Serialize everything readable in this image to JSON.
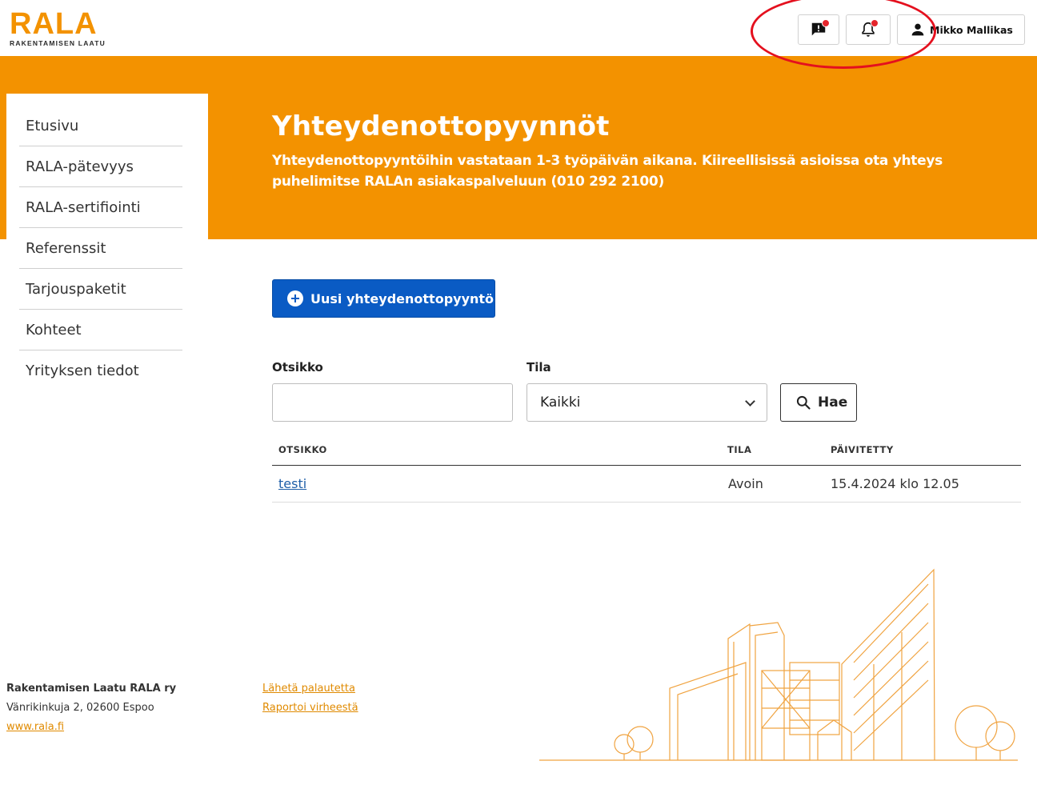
{
  "brand": {
    "logo_text": "RALA",
    "logo_subtitle": "RAKENTAMISEN LAATU",
    "accent_color": "#f39200",
    "primary_button_color": "#0a5bc4"
  },
  "header": {
    "messages_icon": "message-alert-icon",
    "notifications_icon": "bell-icon",
    "user_icon": "person-icon",
    "user_name": "Mikko Mallikas"
  },
  "hero": {
    "title": "Yhteydenottopyynnöt",
    "description": "Yhteydenottopyyntöihin vastataan 1-3 työpäivän aikana. Kiireellisissä asioissa ota yhteys puhelimitse RALAn asiakaspalveluun (010 292 2100)"
  },
  "sidebar": {
    "items": [
      {
        "label": "Etusivu"
      },
      {
        "label": "RALA-pätevyys"
      },
      {
        "label": "RALA-sertifiointi"
      },
      {
        "label": "Referenssit"
      },
      {
        "label": "Tarjouspaketit"
      },
      {
        "label": "Kohteet"
      },
      {
        "label": "Yrityksen tiedot"
      }
    ]
  },
  "main": {
    "new_request_label": "Uusi yhteydenottopyyntö",
    "filters": {
      "title_label": "Otsikko",
      "title_value": "",
      "status_label": "Tila",
      "status_selected": "Kaikki",
      "search_label": "Hae"
    },
    "table": {
      "columns": [
        "OTSIKKO",
        "TILA",
        "PÄIVITETTY"
      ],
      "rows": [
        {
          "title": "testi",
          "status": "Avoin",
          "updated": "15.4.2024 klo 12.05"
        }
      ]
    }
  },
  "footer": {
    "org_name": "Rakentamisen Laatu RALA ry",
    "address": "Vänrikinkuja 2, 02600 Espoo",
    "website": "www.rala.fi",
    "feedback_link": "Lähetä palautetta",
    "bug_report_link": "Raportoi virheestä"
  }
}
